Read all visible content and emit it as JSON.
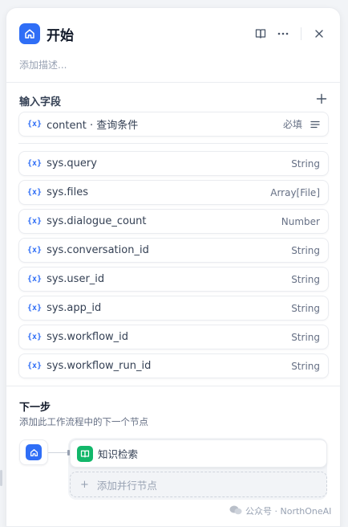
{
  "panel": {
    "title": "开始",
    "description_placeholder": "添加描述..."
  },
  "input_fields": {
    "section_title": "输入字段",
    "custom": {
      "var_icon": "{x}",
      "name": "content · 查询条件",
      "required": "必填"
    },
    "system": [
      {
        "name": "sys.query",
        "type": "String"
      },
      {
        "name": "sys.files",
        "type": "Array[File]"
      },
      {
        "name": "sys.dialogue_count",
        "type": "Number"
      },
      {
        "name": "sys.conversation_id",
        "type": "String"
      },
      {
        "name": "sys.user_id",
        "type": "String"
      },
      {
        "name": "sys.app_id",
        "type": "String"
      },
      {
        "name": "sys.workflow_id",
        "type": "String"
      },
      {
        "name": "sys.workflow_run_id",
        "type": "String"
      }
    ]
  },
  "next_step": {
    "title": "下一步",
    "description": "添加此工作流程中的下一个节点",
    "next_node_label": "知识检索",
    "add_parallel_label": "添加并行节点"
  },
  "watermark": "公众号 · NorthOneAI",
  "colors": {
    "accent": "#2f6ef6",
    "knowledge": "#12b76a"
  },
  "icons": [
    "home-icon",
    "book-icon",
    "more-icon",
    "close-icon",
    "plus-icon",
    "list-icon",
    "knowledge-icon"
  ]
}
